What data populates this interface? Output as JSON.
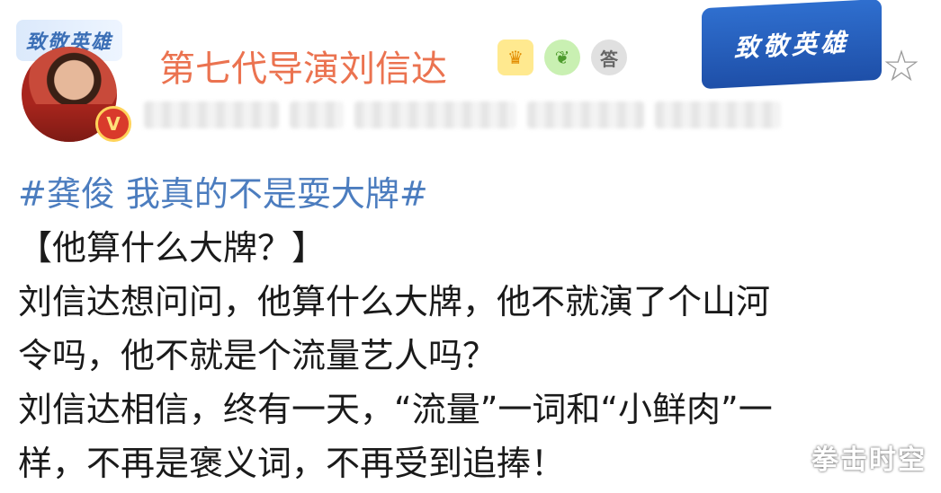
{
  "post": {
    "username": "第七代导演刘信达",
    "avatar_badge_text": "致敬英雄",
    "verified_mark": "V",
    "hero_badge_text": "致敬英雄",
    "user_badges": {
      "badge_1": "♛",
      "badge_2": "❦",
      "badge_3": "答"
    },
    "hashtag": "#龚俊 我真的不是耍大牌#",
    "lines": [
      "【他算什么大牌？】",
      "刘信达想问问，他算什么大牌，他不就演了个山河",
      "令吗，他不就是个流量艺人吗？",
      "刘信达相信，终有一天，“流量”一词和“小鲜肉”一",
      "样，不再是褒义词，不再受到追捧！"
    ]
  },
  "watermark": "拳击时空",
  "icons": {
    "star": "☆"
  },
  "colors": {
    "username": "#eb7350",
    "hashtag": "#4c7dbf",
    "text": "#1a1a1a"
  }
}
